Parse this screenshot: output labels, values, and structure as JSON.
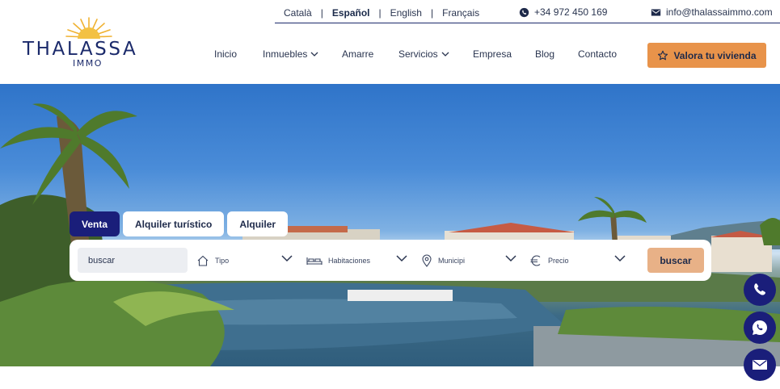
{
  "brand": {
    "name": "THALASSA",
    "sub": "IMMO"
  },
  "languages": [
    {
      "label": "Català",
      "active": false
    },
    {
      "label": "Español",
      "active": true
    },
    {
      "label": "English",
      "active": false
    },
    {
      "label": "Français",
      "active": false
    }
  ],
  "contact": {
    "phone": "+34 972 450 169",
    "email": "info@thalassaimmo.com"
  },
  "nav": [
    {
      "label": "Inicio",
      "dropdown": false
    },
    {
      "label": "Inmuebles",
      "dropdown": true
    },
    {
      "label": "Amarre",
      "dropdown": false
    },
    {
      "label": "Servicios",
      "dropdown": true
    },
    {
      "label": "Empresa",
      "dropdown": false
    },
    {
      "label": "Blog",
      "dropdown": false
    },
    {
      "label": "Contacto",
      "dropdown": false
    }
  ],
  "cta": {
    "label": "Valora tu vivienda"
  },
  "search": {
    "tabs": [
      {
        "label": "Venta",
        "active": true
      },
      {
        "label": "Alquiler turístico",
        "active": false
      },
      {
        "label": "Alquiler",
        "active": false
      }
    ],
    "input_placeholder": "buscar",
    "filters": [
      {
        "label": "Tipo",
        "icon": "home-icon"
      },
      {
        "label": "Habitaciones",
        "icon": "bed-icon"
      },
      {
        "label": "Municipi",
        "icon": "location-pin-icon"
      },
      {
        "label": "Precio",
        "icon": "euro-icon"
      }
    ],
    "button_label": "buscar"
  },
  "colors": {
    "navy": "#1a1e7a",
    "accent": "#e8934a",
    "search_button": "#e8b187"
  }
}
